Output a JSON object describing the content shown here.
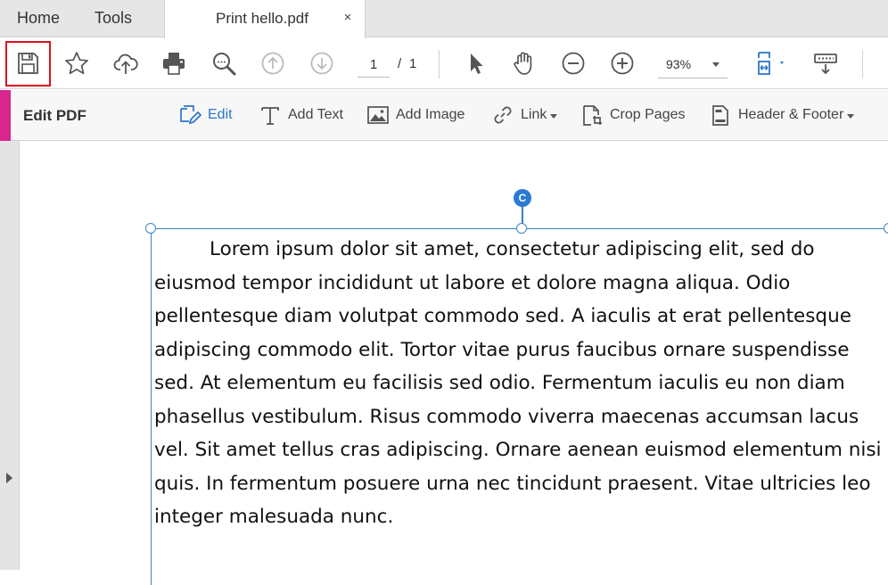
{
  "tabs": {
    "home": "Home",
    "tools": "Tools",
    "document": "Print hello.pdf",
    "close_glyph": "×"
  },
  "toolbar": {
    "icons": [
      "save-icon",
      "bookmark-star-icon",
      "cloud-upload-icon",
      "print-icon",
      "zoom-search-icon",
      "previous-page-icon",
      "next-page-icon",
      "select-arrow-icon",
      "hand-tool-icon",
      "zoom-out-icon",
      "zoom-in-icon",
      "page-fit-icon",
      "scroll-mode-icon"
    ],
    "page_current": "1",
    "page_separator": "/",
    "page_total": "1",
    "zoom": "93%"
  },
  "edit_bar": {
    "title": "Edit PDF",
    "tools": {
      "edit": "Edit",
      "add_text": "Add Text",
      "add_image": "Add Image",
      "link": "Link",
      "crop_pages": "Crop Pages",
      "header_footer": "Header & Footer"
    }
  },
  "document": {
    "paragraph": "Lorem ipsum dolor sit amet, consectetur adipiscing elit, sed do eiusmod tempor incididunt ut labore et dolore magna aliqua. Odio pellentesque diam volutpat commodo sed. A iaculis at erat pellentesque adipiscing commodo elit. Tortor vitae purus faucibus ornare suspendisse sed. At elementum eu facilisis sed odio. Fermentum iaculis eu non diam phasellus vestibulum. Risus commodo viverra maecenas accumsan lacus vel. Sit amet tellus cras adipiscing. Ornare aenean euismod elementum nisi quis. In fermentum posuere urna nec tincidunt praesent. Vitae ultricies leo integer malesuada nunc."
  },
  "colors": {
    "accent_blue": "#2a76c9",
    "edit_bar_accent": "#d9268e",
    "save_highlight": "#e01020"
  }
}
